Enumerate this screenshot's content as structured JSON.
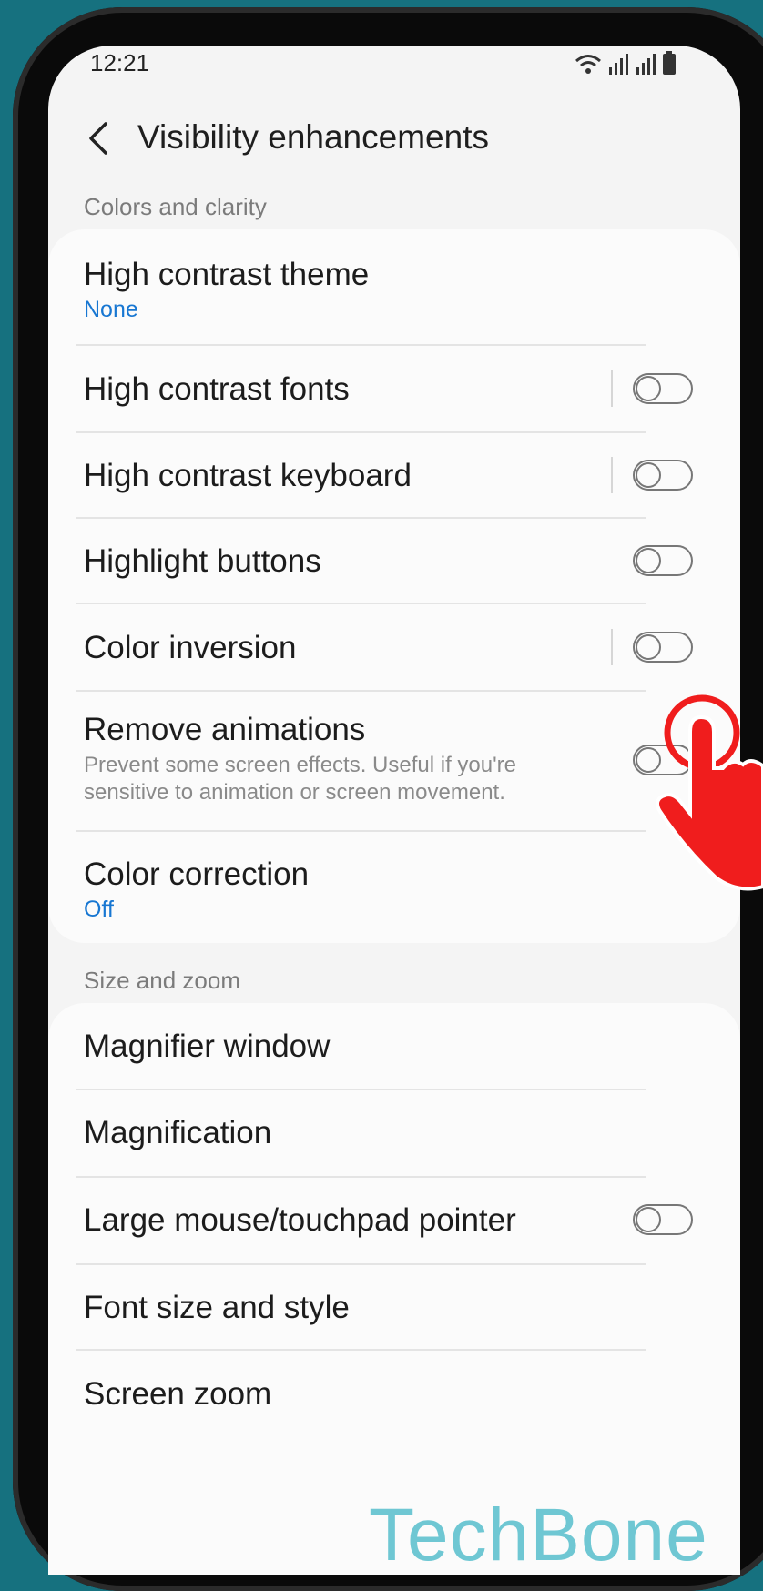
{
  "status_bar": {
    "time": "12:21"
  },
  "header": {
    "title": "Visibility enhancements"
  },
  "sections": {
    "colors": {
      "label": "Colors and clarity",
      "items": [
        {
          "title": "High contrast theme",
          "subtitle": "None"
        },
        {
          "title": "High contrast fonts",
          "toggle": false
        },
        {
          "title": "High contrast keyboard",
          "toggle": false
        },
        {
          "title": "Highlight buttons",
          "toggle": false
        },
        {
          "title": "Color inversion",
          "toggle": false
        },
        {
          "title": "Remove animations",
          "description": "Prevent some screen effects. Useful if you're sensitive to animation or screen movement.",
          "toggle": false
        },
        {
          "title": "Color correction",
          "subtitle": "Off"
        }
      ]
    },
    "size": {
      "label": "Size and zoom",
      "items": [
        {
          "title": "Magnifier window"
        },
        {
          "title": "Magnification"
        },
        {
          "title": "Large mouse/touchpad pointer",
          "toggle": false
        },
        {
          "title": "Font size and style"
        },
        {
          "title": "Screen zoom"
        }
      ]
    }
  },
  "watermark": "TechBone",
  "colors": {
    "background": "#16717f",
    "accent": "#1877d2",
    "pointer": "#f01d1d",
    "watermark": "#6fc7d3"
  }
}
